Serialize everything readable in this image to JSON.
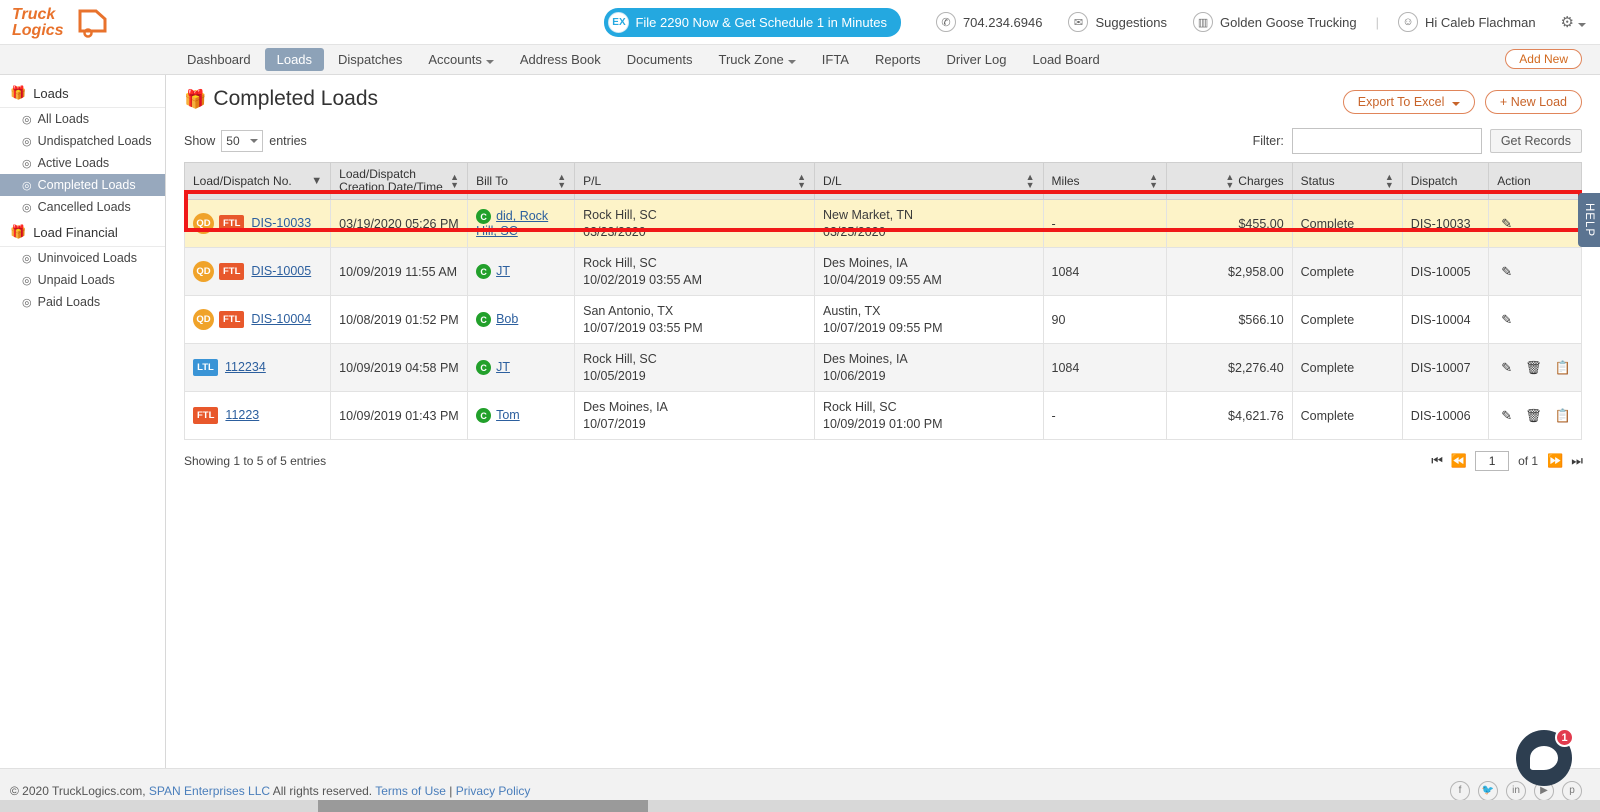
{
  "topbar": {
    "logo_line1": "Truck",
    "logo_line2": "Logics",
    "promo": {
      "badge": "EX",
      "text": "File 2290 Now & Get Schedule 1 in Minutes"
    },
    "phone": "704.234.6946",
    "suggestions": "Suggestions",
    "company": "Golden Goose Trucking",
    "divider": "|",
    "user": "Hi Caleb Flachman",
    "gear_icon": "gear-icon"
  },
  "nav": {
    "items": [
      {
        "label": "Dashboard",
        "active": false,
        "caret": false
      },
      {
        "label": "Loads",
        "active": true,
        "caret": false
      },
      {
        "label": "Dispatches",
        "active": false,
        "caret": false
      },
      {
        "label": "Accounts",
        "active": false,
        "caret": true
      },
      {
        "label": "Address Book",
        "active": false,
        "caret": false
      },
      {
        "label": "Documents",
        "active": false,
        "caret": false
      },
      {
        "label": "Truck Zone",
        "active": false,
        "caret": true
      },
      {
        "label": "IFTA",
        "active": false,
        "caret": false
      },
      {
        "label": "Reports",
        "active": false,
        "caret": false
      },
      {
        "label": "Driver Log",
        "active": false,
        "caret": false
      },
      {
        "label": "Load Board",
        "active": false,
        "caret": false
      }
    ],
    "add_new": "Add New"
  },
  "sidebar": {
    "groups": [
      {
        "title": "Loads",
        "icon": "box-icon",
        "items": [
          {
            "label": "All Loads",
            "active": false
          },
          {
            "label": "Undispatched Loads",
            "active": false
          },
          {
            "label": "Active Loads",
            "active": false
          },
          {
            "label": "Completed Loads",
            "active": true
          },
          {
            "label": "Cancelled Loads",
            "active": false
          }
        ]
      },
      {
        "title": "Load Financial",
        "icon": "box-icon",
        "items": [
          {
            "label": "Uninvoiced Loads",
            "active": false
          },
          {
            "label": "Unpaid Loads",
            "active": false
          },
          {
            "label": "Paid Loads",
            "active": false
          }
        ]
      }
    ]
  },
  "main": {
    "title": "Completed Loads",
    "title_icon": "box-icon",
    "export_button": "Export To Excel",
    "new_load_button": "New Load",
    "show_label": "Show",
    "entries_label": "entries",
    "entries_value": "50",
    "filter_label": "Filter:",
    "filter_value": "",
    "filter_placeholder": "",
    "get_records_button": "Get Records",
    "help_tab": "HELP"
  },
  "table": {
    "columns": [
      {
        "label": "Load/Dispatch No.",
        "sort": "desc",
        "align": "left"
      },
      {
        "label": "Load/Dispatch Creation Date/Time",
        "sort": "both",
        "align": "left"
      },
      {
        "label": "Bill To",
        "sort": "both",
        "align": "left"
      },
      {
        "label": "P/L",
        "sort": "both",
        "align": "left"
      },
      {
        "label": "D/L",
        "sort": "both",
        "align": "left"
      },
      {
        "label": "Miles",
        "sort": "both",
        "align": "left"
      },
      {
        "label": "Charges",
        "sort": "both",
        "align": "right"
      },
      {
        "label": "Status",
        "sort": "both",
        "align": "left"
      },
      {
        "label": "Dispatch",
        "sort": "none",
        "align": "left"
      },
      {
        "label": "Action",
        "sort": "none",
        "align": "left"
      }
    ],
    "rows": [
      {
        "qd": "QD",
        "type": "FTL",
        "type_class": "badge-ftl",
        "load_no": "DIS-10033",
        "created": "03/19/2020 05:26 PM",
        "bill_to": "did, Rock Hill, SC",
        "bill_to_initial": "C",
        "pl_city": "Rock Hill, SC",
        "pl_date": "03/23/2020",
        "dl_city": "New Market, TN",
        "dl_date": "03/25/2020",
        "miles": "-",
        "charges": "$455.00",
        "status": "Complete",
        "dispatch": "DIS-10033",
        "actions": [
          "edit"
        ],
        "highlighted": true
      },
      {
        "qd": "QD",
        "type": "FTL",
        "type_class": "badge-ftl",
        "load_no": "DIS-10005",
        "created": "10/09/2019 11:55 AM",
        "bill_to": "JT",
        "bill_to_initial": "C",
        "pl_city": "Rock Hill, SC",
        "pl_date": "10/02/2019 03:55 AM",
        "dl_city": "Des Moines, IA",
        "dl_date": "10/04/2019 09:55 AM",
        "miles": "1084",
        "charges": "$2,958.00",
        "status": "Complete",
        "dispatch": "DIS-10005",
        "actions": [
          "edit"
        ],
        "highlighted": false
      },
      {
        "qd": "QD",
        "type": "FTL",
        "type_class": "badge-ftl",
        "load_no": "DIS-10004",
        "created": "10/08/2019 01:52 PM",
        "bill_to": "Bob",
        "bill_to_initial": "C",
        "pl_city": "San Antonio, TX",
        "pl_date": "10/07/2019 03:55 PM",
        "dl_city": "Austin, TX",
        "dl_date": "10/07/2019 09:55 PM",
        "miles": "90",
        "charges": "$566.10",
        "status": "Complete",
        "dispatch": "DIS-10004",
        "actions": [
          "edit"
        ],
        "highlighted": false
      },
      {
        "qd": "",
        "type": "LTL",
        "type_class": "badge-ltl",
        "load_no": "112234",
        "created": "10/09/2019 04:58 PM",
        "bill_to": "JT",
        "bill_to_initial": "C",
        "pl_city": "Rock Hill, SC",
        "pl_date": "10/05/2019",
        "dl_city": "Des Moines, IA",
        "dl_date": "10/06/2019",
        "miles": "1084",
        "charges": "$2,276.40",
        "status": "Complete",
        "dispatch": "DIS-10007",
        "actions": [
          "edit",
          "delete",
          "invoice"
        ],
        "highlighted": false
      },
      {
        "qd": "",
        "type": "FTL",
        "type_class": "badge-ftl",
        "load_no": "11223",
        "created": "10/09/2019 01:43 PM",
        "bill_to": "Tom",
        "bill_to_initial": "C",
        "pl_city": "Des Moines, IA",
        "pl_date": "10/07/2019",
        "dl_city": "Rock Hill, SC",
        "dl_date": "10/09/2019 01:00 PM",
        "miles": "-",
        "charges": "$4,621.76",
        "status": "Complete",
        "dispatch": "DIS-10006",
        "actions": [
          "edit",
          "delete",
          "invoice"
        ],
        "highlighted": false
      }
    ],
    "footer": {
      "showing": "Showing 1 to 5 of 5 entries",
      "page_value": "1",
      "of_label": "of 1"
    }
  },
  "footer": {
    "copyright_pre": "© 2020 TruckLogics.com, ",
    "company_link": "SPAN Enterprises LLC",
    "copyright_post": " All rights reserved. ",
    "terms": "Terms of Use",
    "sep": " | ",
    "privacy": "Privacy Policy",
    "socials": [
      "facebook-icon",
      "twitter-icon",
      "linkedin-icon",
      "youtube-icon",
      "pinterest-icon"
    ],
    "chat_badge": "1"
  },
  "colors": {
    "brand_orange": "#e8722c",
    "accent_blue": "#24a8e0",
    "highlight_row": "#fdf3c8",
    "highlight_border": "#f01818",
    "nav_active": "#8da2b8",
    "ftl_badge": "#e8582c",
    "ltl_badge": "#3a94d6",
    "qd_badge": "#f0a32a",
    "customer_badge": "#22a02b"
  }
}
